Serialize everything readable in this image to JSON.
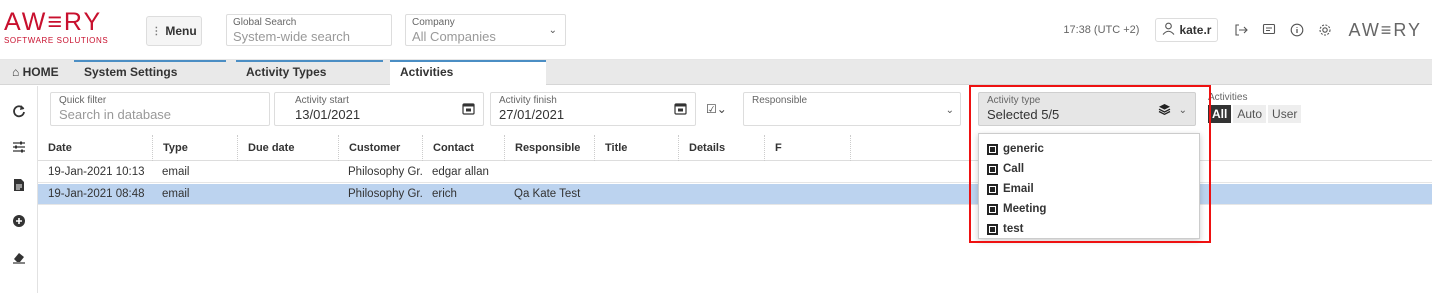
{
  "header": {
    "logo": "AW≡RY",
    "logo_sub": "SOFTWARE SOLUTIONS",
    "menu_label": "Menu",
    "global_search": {
      "label": "Global Search",
      "placeholder": "System-wide search"
    },
    "company": {
      "label": "Company",
      "value": "All Companies"
    },
    "time": "17:38 (UTC +2)",
    "user": "kate.r",
    "logo_right": "AW≡RY"
  },
  "tabs": [
    {
      "label": "HOME"
    },
    {
      "label": "System Settings"
    },
    {
      "label": "Activity Types"
    },
    {
      "label": "Activities"
    }
  ],
  "filters": {
    "quick_filter": {
      "label": "Quick filter",
      "placeholder": "Search in database"
    },
    "activity_start": {
      "label": "Activity start",
      "value": "13/01/2021"
    },
    "activity_finish": {
      "label": "Activity finish",
      "value": "27/01/2021"
    },
    "responsible": {
      "label": "Responsible",
      "value": ""
    },
    "activity_type": {
      "label": "Activity type",
      "value": "Selected 5/5"
    },
    "activities": {
      "label": "Activities",
      "options": [
        "All",
        "Auto",
        "User"
      ],
      "selected": "All"
    }
  },
  "grid": {
    "columns": [
      "Date",
      "Type",
      "Due date",
      "Customer",
      "Contact",
      "Responsible",
      "Title",
      "Details",
      "F"
    ],
    "rows": [
      {
        "date": "19-Jan-2021 10:13",
        "type": "email",
        "due": "",
        "customer": "Philosophy Gr...",
        "contact": "edgar allan",
        "responsible": "",
        "title": "",
        "details": ""
      },
      {
        "date": "19-Jan-2021 08:48",
        "type": "email",
        "due": "",
        "customer": "Philosophy Gr...",
        "contact": "erich",
        "responsible": "Qa Kate Test",
        "title": "",
        "details": ""
      }
    ]
  },
  "activity_type_options": [
    "generic",
    "Call",
    "Email",
    "Meeting",
    "test"
  ],
  "colors": {
    "brand": "#c8102e",
    "highlight": "#e11111",
    "tab_accent": "#4b8ec4",
    "row_selected": "#bcd3ef"
  }
}
